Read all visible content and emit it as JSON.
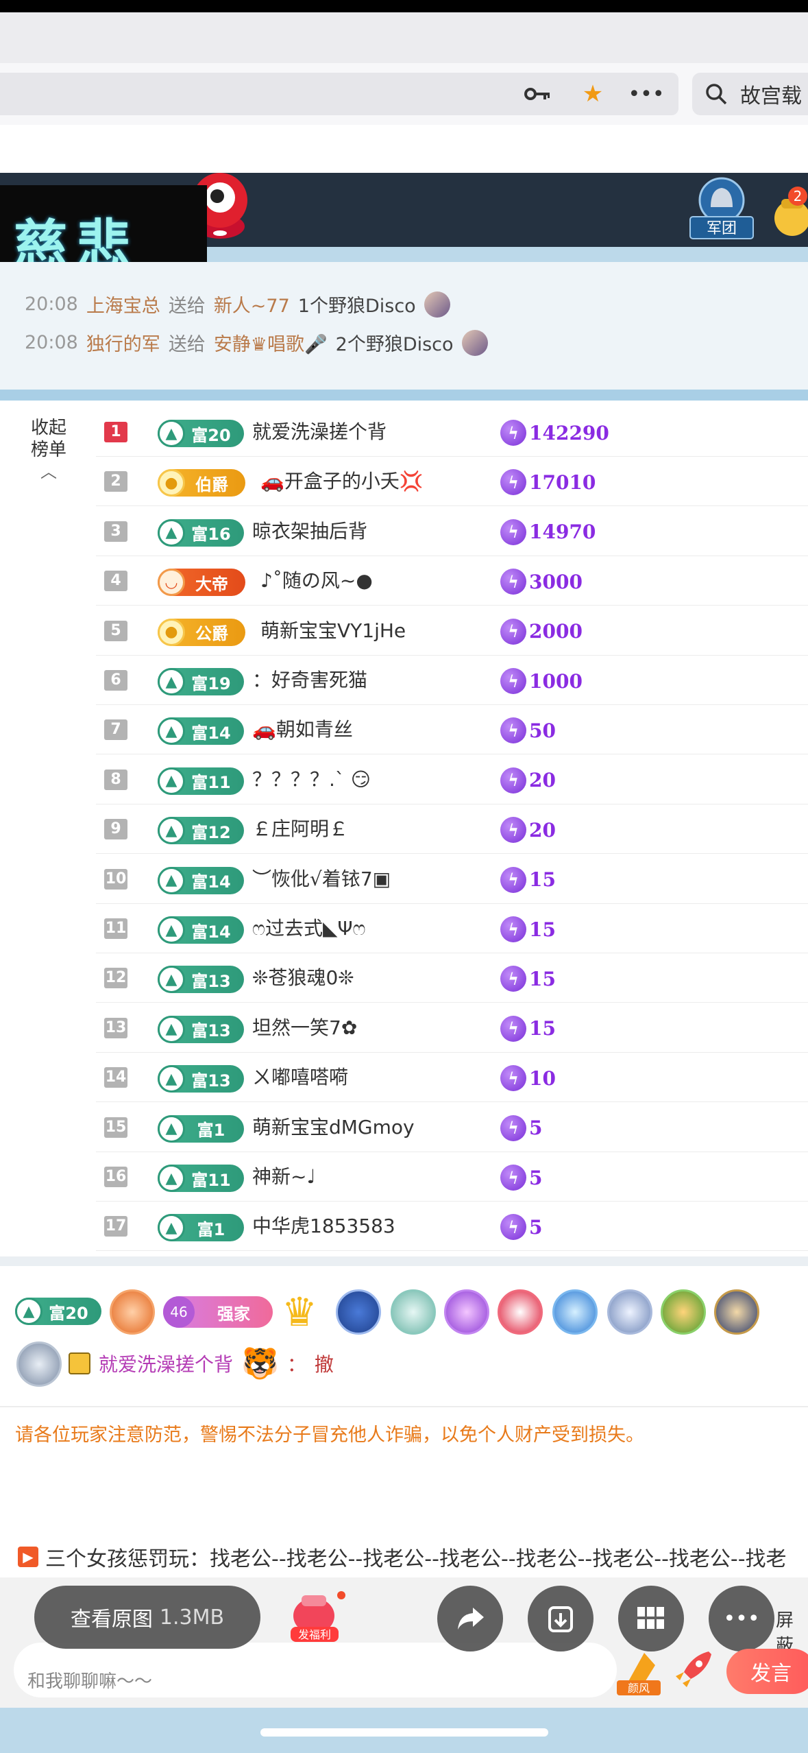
{
  "browser": {
    "search_text": "故宫载",
    "icons": [
      "key-icon",
      "star-icon",
      "more-icon",
      "search-icon"
    ]
  },
  "room": {
    "title": "慈悲",
    "legion_label": "军团",
    "badge_count": "2"
  },
  "gift_feed": [
    {
      "time": "20:08",
      "sender": "上海宝总",
      "verb": "送给",
      "receiver": "新人~77",
      "item": "1个野狼Disco"
    },
    {
      "time": "20:08",
      "sender": "独行的军",
      "verb": "送给",
      "receiver": "安静♛唱歌🎤",
      "item": "2个野狼Disco"
    }
  ],
  "leaderboard": {
    "collapse_label_1": "收起",
    "collapse_label_2": "榜单",
    "rows": [
      {
        "rank": "1",
        "badge_type": "fu",
        "badge_label": "富20",
        "name": "就爱洗澡搓个背",
        "score": "142290"
      },
      {
        "rank": "2",
        "badge_type": "gold",
        "badge_label": "伯爵",
        "name": "🚗开盒子的小夭💢",
        "score": "17010"
      },
      {
        "rank": "3",
        "badge_type": "fu",
        "badge_label": "富16",
        "name": "晾衣架抽后背",
        "score": "14970"
      },
      {
        "rank": "4",
        "badge_type": "red",
        "badge_label": "大帝",
        "name": "♪˚随の风~●",
        "score": "3000"
      },
      {
        "rank": "5",
        "badge_type": "gold",
        "badge_label": "公爵",
        "name": "萌新宝宝VY1jHe",
        "score": "2000"
      },
      {
        "rank": "6",
        "badge_type": "fu",
        "badge_label": "富19",
        "name": "：好奇害死猫",
        "score": "1000"
      },
      {
        "rank": "7",
        "badge_type": "fu",
        "badge_label": "富14",
        "name": "🚗朝如青丝",
        "score": "50"
      },
      {
        "rank": "8",
        "badge_type": "fu",
        "badge_label": "富11",
        "name": "？？？？.` 😏",
        "score": "20"
      },
      {
        "rank": "9",
        "badge_type": "fu",
        "badge_label": "富12",
        "name": "￡庄阿明￡",
        "score": "20"
      },
      {
        "rank": "10",
        "badge_type": "fu",
        "badge_label": "富14",
        "name": "︶恢仳√着铱7▣",
        "score": "15"
      },
      {
        "rank": "11",
        "badge_type": "fu",
        "badge_label": "富14",
        "name": "ෆ过去式◣Ψෆ",
        "score": "15"
      },
      {
        "rank": "12",
        "badge_type": "fu",
        "badge_label": "富13",
        "name": "❊苍狼魂0❊",
        "score": "15"
      },
      {
        "rank": "13",
        "badge_type": "fu",
        "badge_label": "富13",
        "name": "坦然一笑7✿",
        "score": "15"
      },
      {
        "rank": "14",
        "badge_type": "fu",
        "badge_label": "富13",
        "name": "ㄨ嘟嘻嗒嗬",
        "score": "10"
      },
      {
        "rank": "15",
        "badge_type": "fu",
        "badge_label": "富1",
        "name": "萌新宝宝dMGmoy",
        "score": "5"
      },
      {
        "rank": "16",
        "badge_type": "fu",
        "badge_label": "富11",
        "name": "神新~♩",
        "score": "5"
      },
      {
        "rank": "17",
        "badge_type": "fu",
        "badge_label": "富1",
        "name": "中华虎1853583",
        "score": "5"
      }
    ]
  },
  "chat": {
    "user_badge": "富20",
    "level_badge": "46",
    "level_text": "强家",
    "sender": "就爱洗澡搓个背",
    "colon": "：",
    "message": "撤"
  },
  "notice": "请各位玩家注意防范，警惕不法分子冒充他人诈骗，以免个人财产受到损失。",
  "marquee": "三个女孩惩罚玩：找老公--找老公--找老公--找老公--找老公--找老公--找老公--找老",
  "viewer": {
    "view_original": "查看原图",
    "size": "1.3MB",
    "gift_label": "发福利",
    "block_label": "屏蔽"
  },
  "input": {
    "placeholder": "和我聊聊嘛～～",
    "speak": "发言",
    "feng_label": "颜风"
  },
  "colors": {
    "accent_green": "#2e9a7a",
    "score_purple": "#8a2be2",
    "rank_first": "#e2394b",
    "speak_button": "#ff5a5a"
  }
}
